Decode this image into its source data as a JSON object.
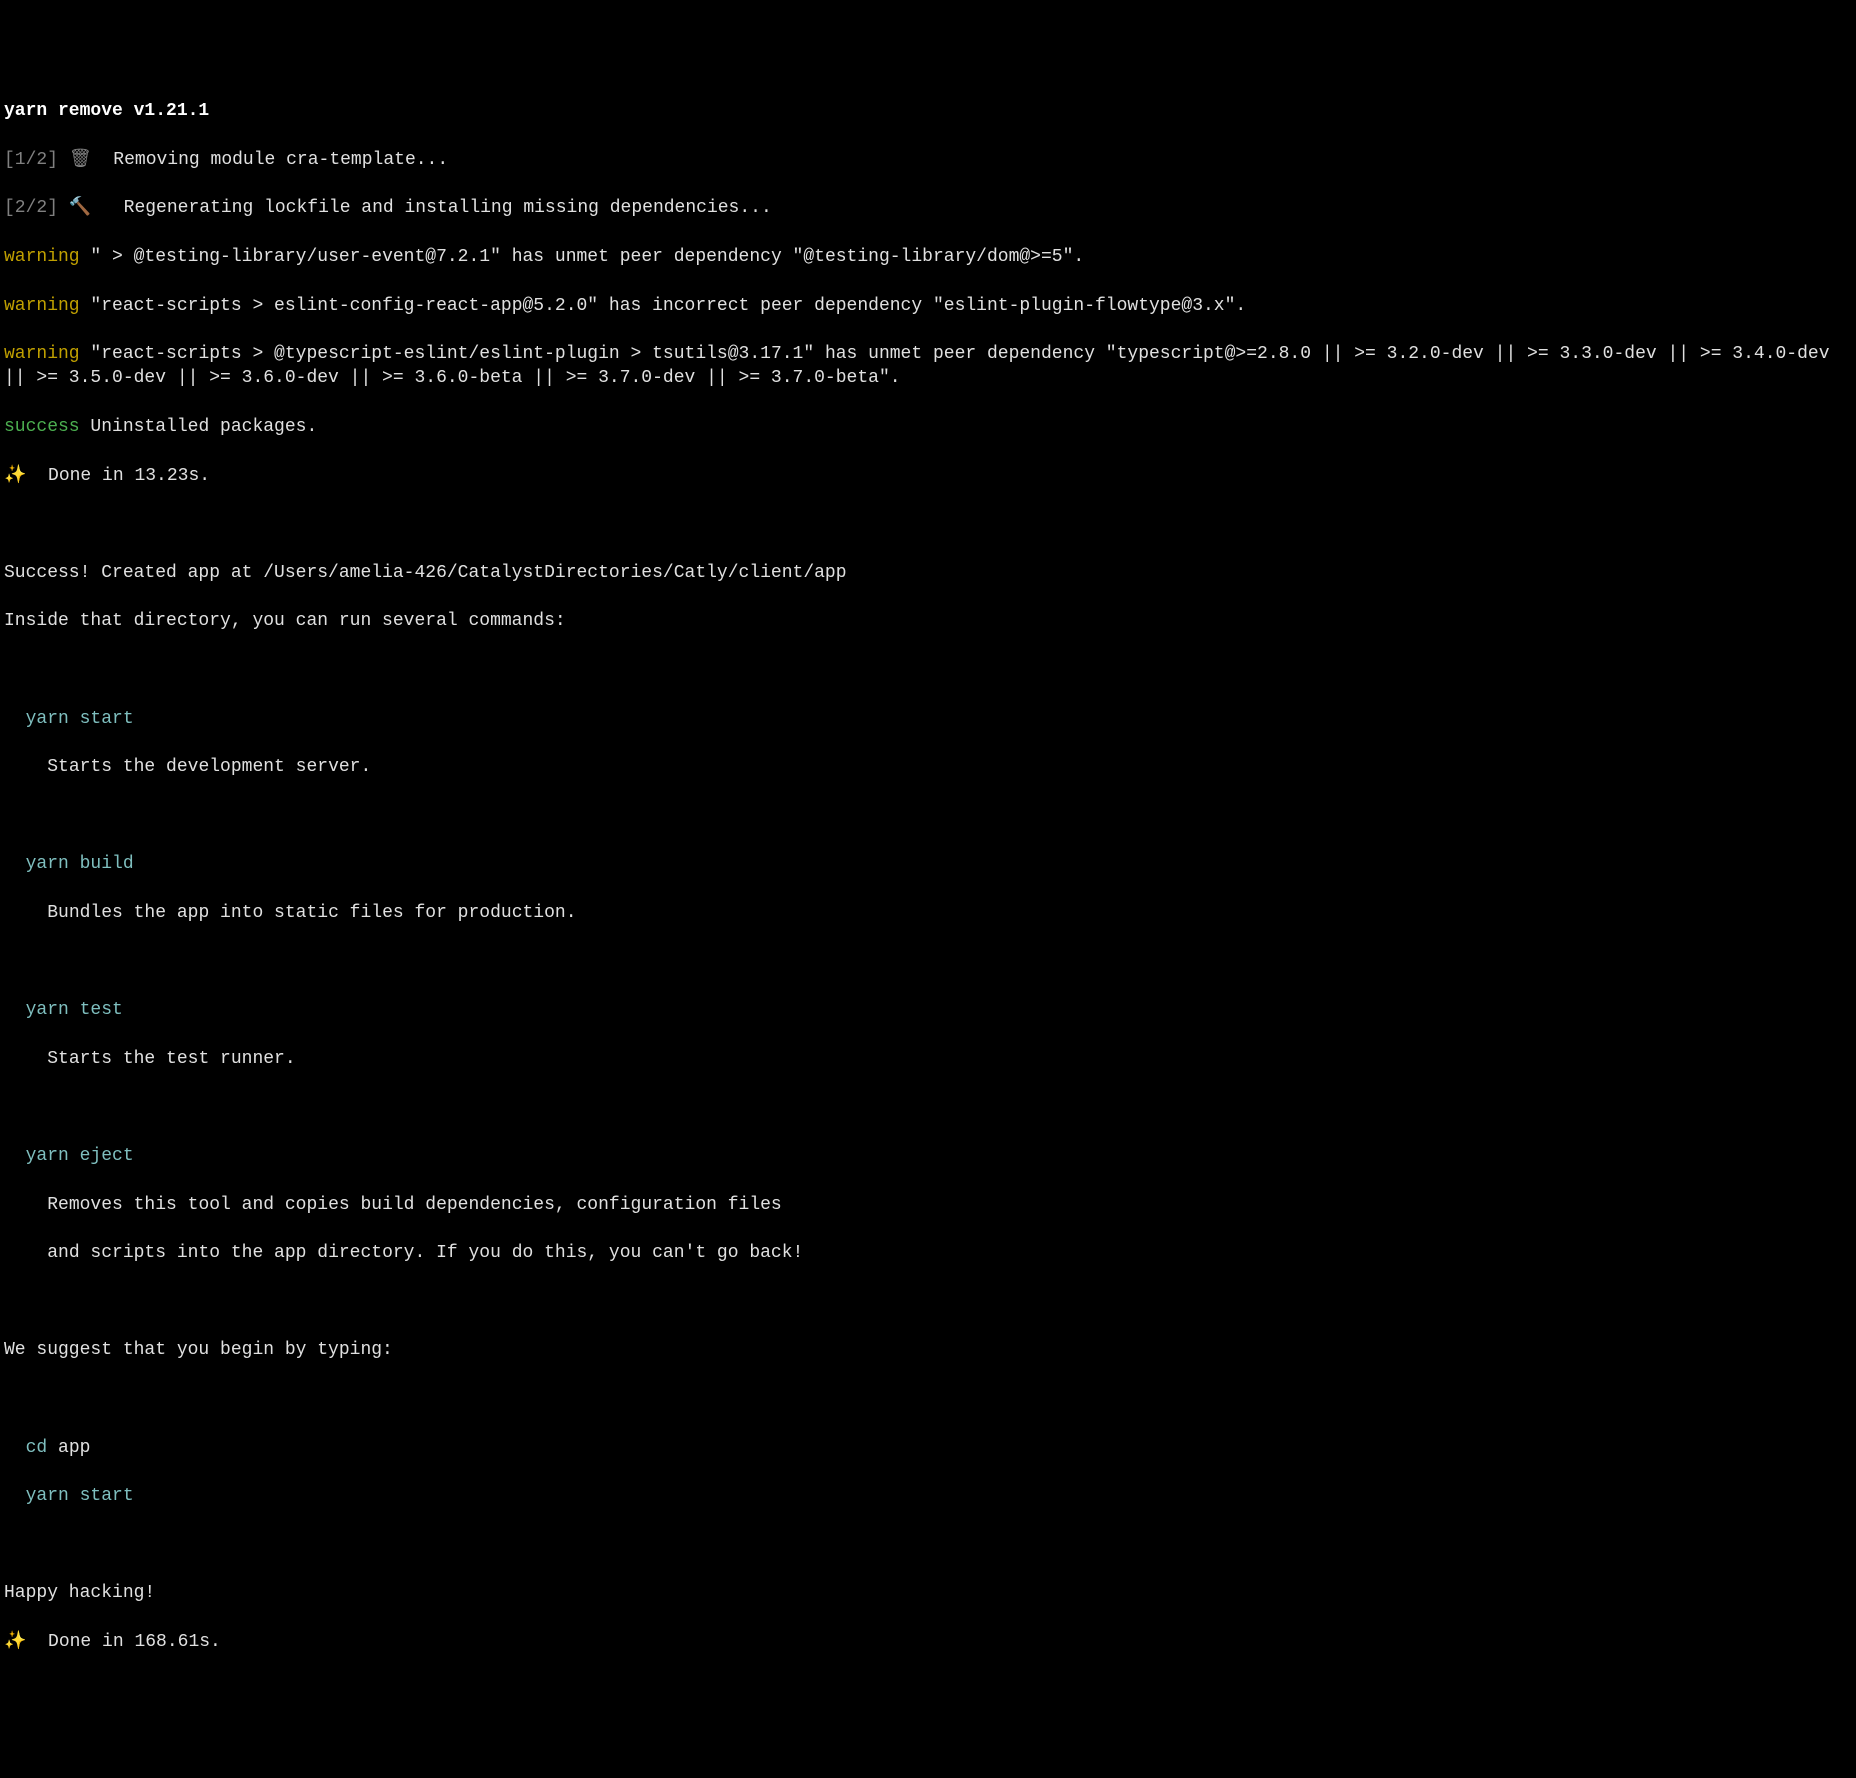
{
  "header": "yarn remove v1.21.1",
  "step1": {
    "label": "[1/2]",
    "icon": "🗑",
    "text": "Removing module cra-template..."
  },
  "step2": {
    "label": "[2/2]",
    "icon": "🔨",
    "text": "Regenerating lockfile and installing missing dependencies..."
  },
  "warnings": {
    "w1_label": "warning",
    "w1_text": " \" > @testing-library/user-event@7.2.1\" has unmet peer dependency \"@testing-library/dom@>=5\".",
    "w2_label": "warning",
    "w2_text": " \"react-scripts > eslint-config-react-app@5.2.0\" has incorrect peer dependency \"eslint-plugin-flowtype@3.x\".",
    "w3_label": "warning",
    "w3_text": " \"react-scripts > @typescript-eslint/eslint-plugin > tsutils@3.17.1\" has unmet peer dependency \"typescript@>=2.8.0 || >= 3.2.0-dev || >= 3.3.0-dev || >= 3.4.0-dev || >= 3.5.0-dev || >= 3.6.0-dev || >= 3.6.0-beta || >= 3.7.0-dev || >= 3.7.0-beta\"."
  },
  "success_label": "success",
  "success_text": " Uninstalled packages.",
  "done1_icon": "✨",
  "done1_text": "  Done in 13.23s.",
  "created_line": "Success! Created app at /Users/amelia-426/CatalystDirectories/Catly/client/app",
  "inside_line": "Inside that directory, you can run several commands:",
  "commands": {
    "start_cmd": "yarn start",
    "start_desc": "Starts the development server.",
    "build_cmd": "yarn build",
    "build_desc": "Bundles the app into static files for production.",
    "test_cmd": "yarn test",
    "test_desc": "Starts the test runner.",
    "eject_cmd": "yarn eject",
    "eject_desc1": "Removes this tool and copies build dependencies, configuration files",
    "eject_desc2": "and scripts into the app directory. If you do this, you can't go back!"
  },
  "suggest_line": "We suggest that you begin by typing:",
  "cd_cmd": "cd",
  "cd_arg": " app",
  "yarn_start_cmd": "yarn start",
  "happy": "Happy hacking!",
  "done2_icon": "✨",
  "done2_text": "  Done in 168.61s."
}
